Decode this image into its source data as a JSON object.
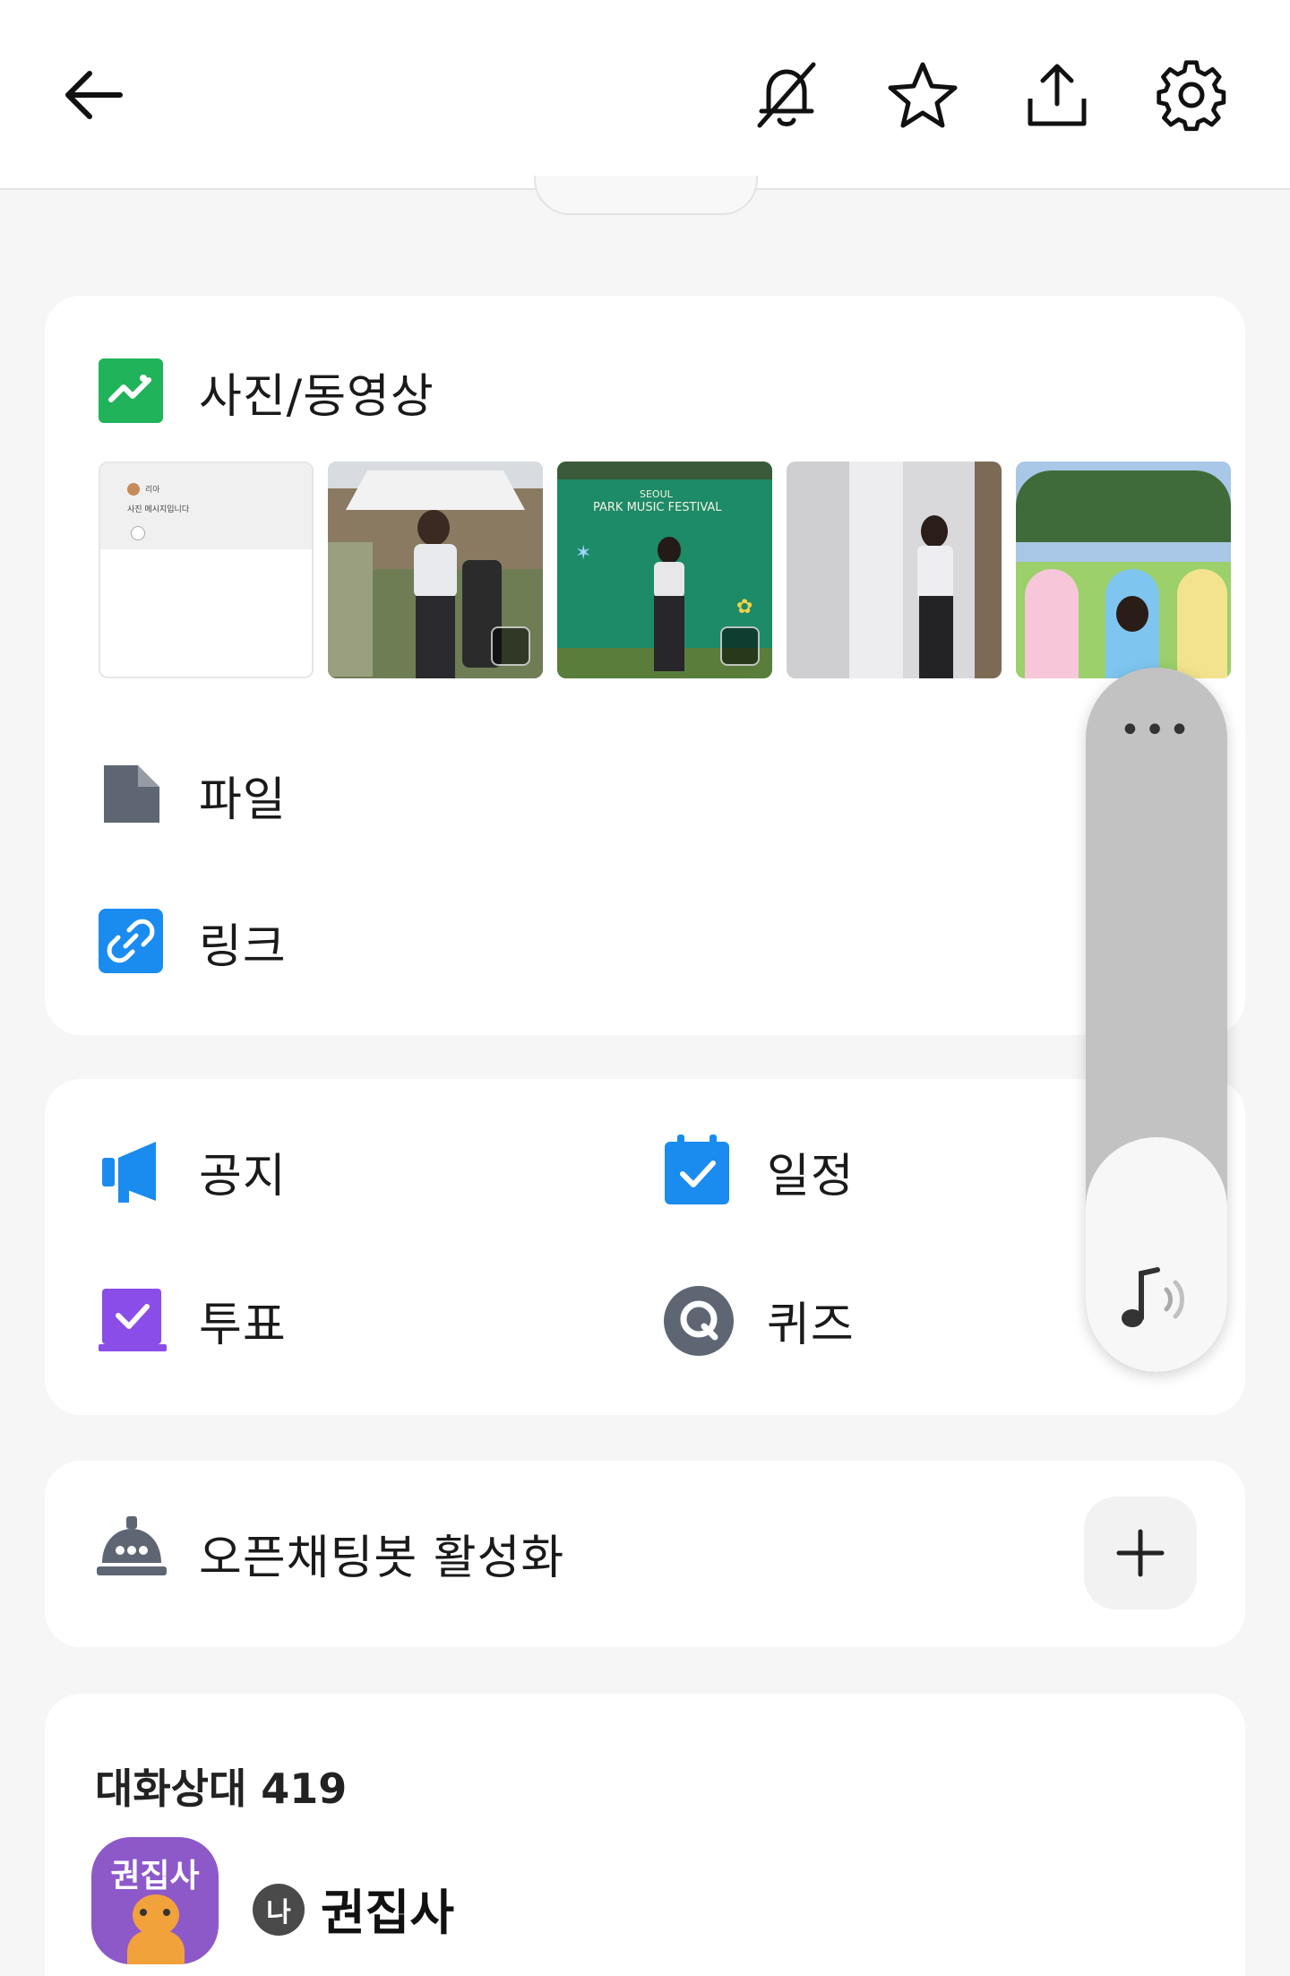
{
  "header": {
    "back_icon": "arrow-left-icon",
    "mute_icon": "bell-off-icon",
    "star_icon": "star-icon",
    "share_icon": "share-upload-icon",
    "settings_icon": "gear-icon"
  },
  "media": {
    "title": "사진/동영상",
    "thumb_text_name": "리아",
    "thumb_text_line": "사진 메시지입니다"
  },
  "festival_sign": {
    "line1": "SEOUL",
    "line2": "PARK MUSIC FESTIVAL"
  },
  "files": {
    "label": "파일"
  },
  "links": {
    "label": "링크"
  },
  "tools": {
    "notice": "공지",
    "schedule": "일정",
    "vote": "투표",
    "quiz": "퀴즈"
  },
  "bot": {
    "label": "오픈채팅봇 활성화"
  },
  "members": {
    "title": "대화상대 419",
    "first": {
      "avatar_text": "권집사",
      "badge": "나",
      "name": "권집사"
    }
  },
  "volume_overlay": {
    "menu_icon": "more-dots-icon",
    "media_icon": "music-note-volume-icon",
    "level": 0.33
  },
  "colors": {
    "green": "#20b35a",
    "blue": "#1a8cf0",
    "purple": "#8a4de8",
    "gray_icon": "#5f6673",
    "avatar": "#8d59c9"
  }
}
